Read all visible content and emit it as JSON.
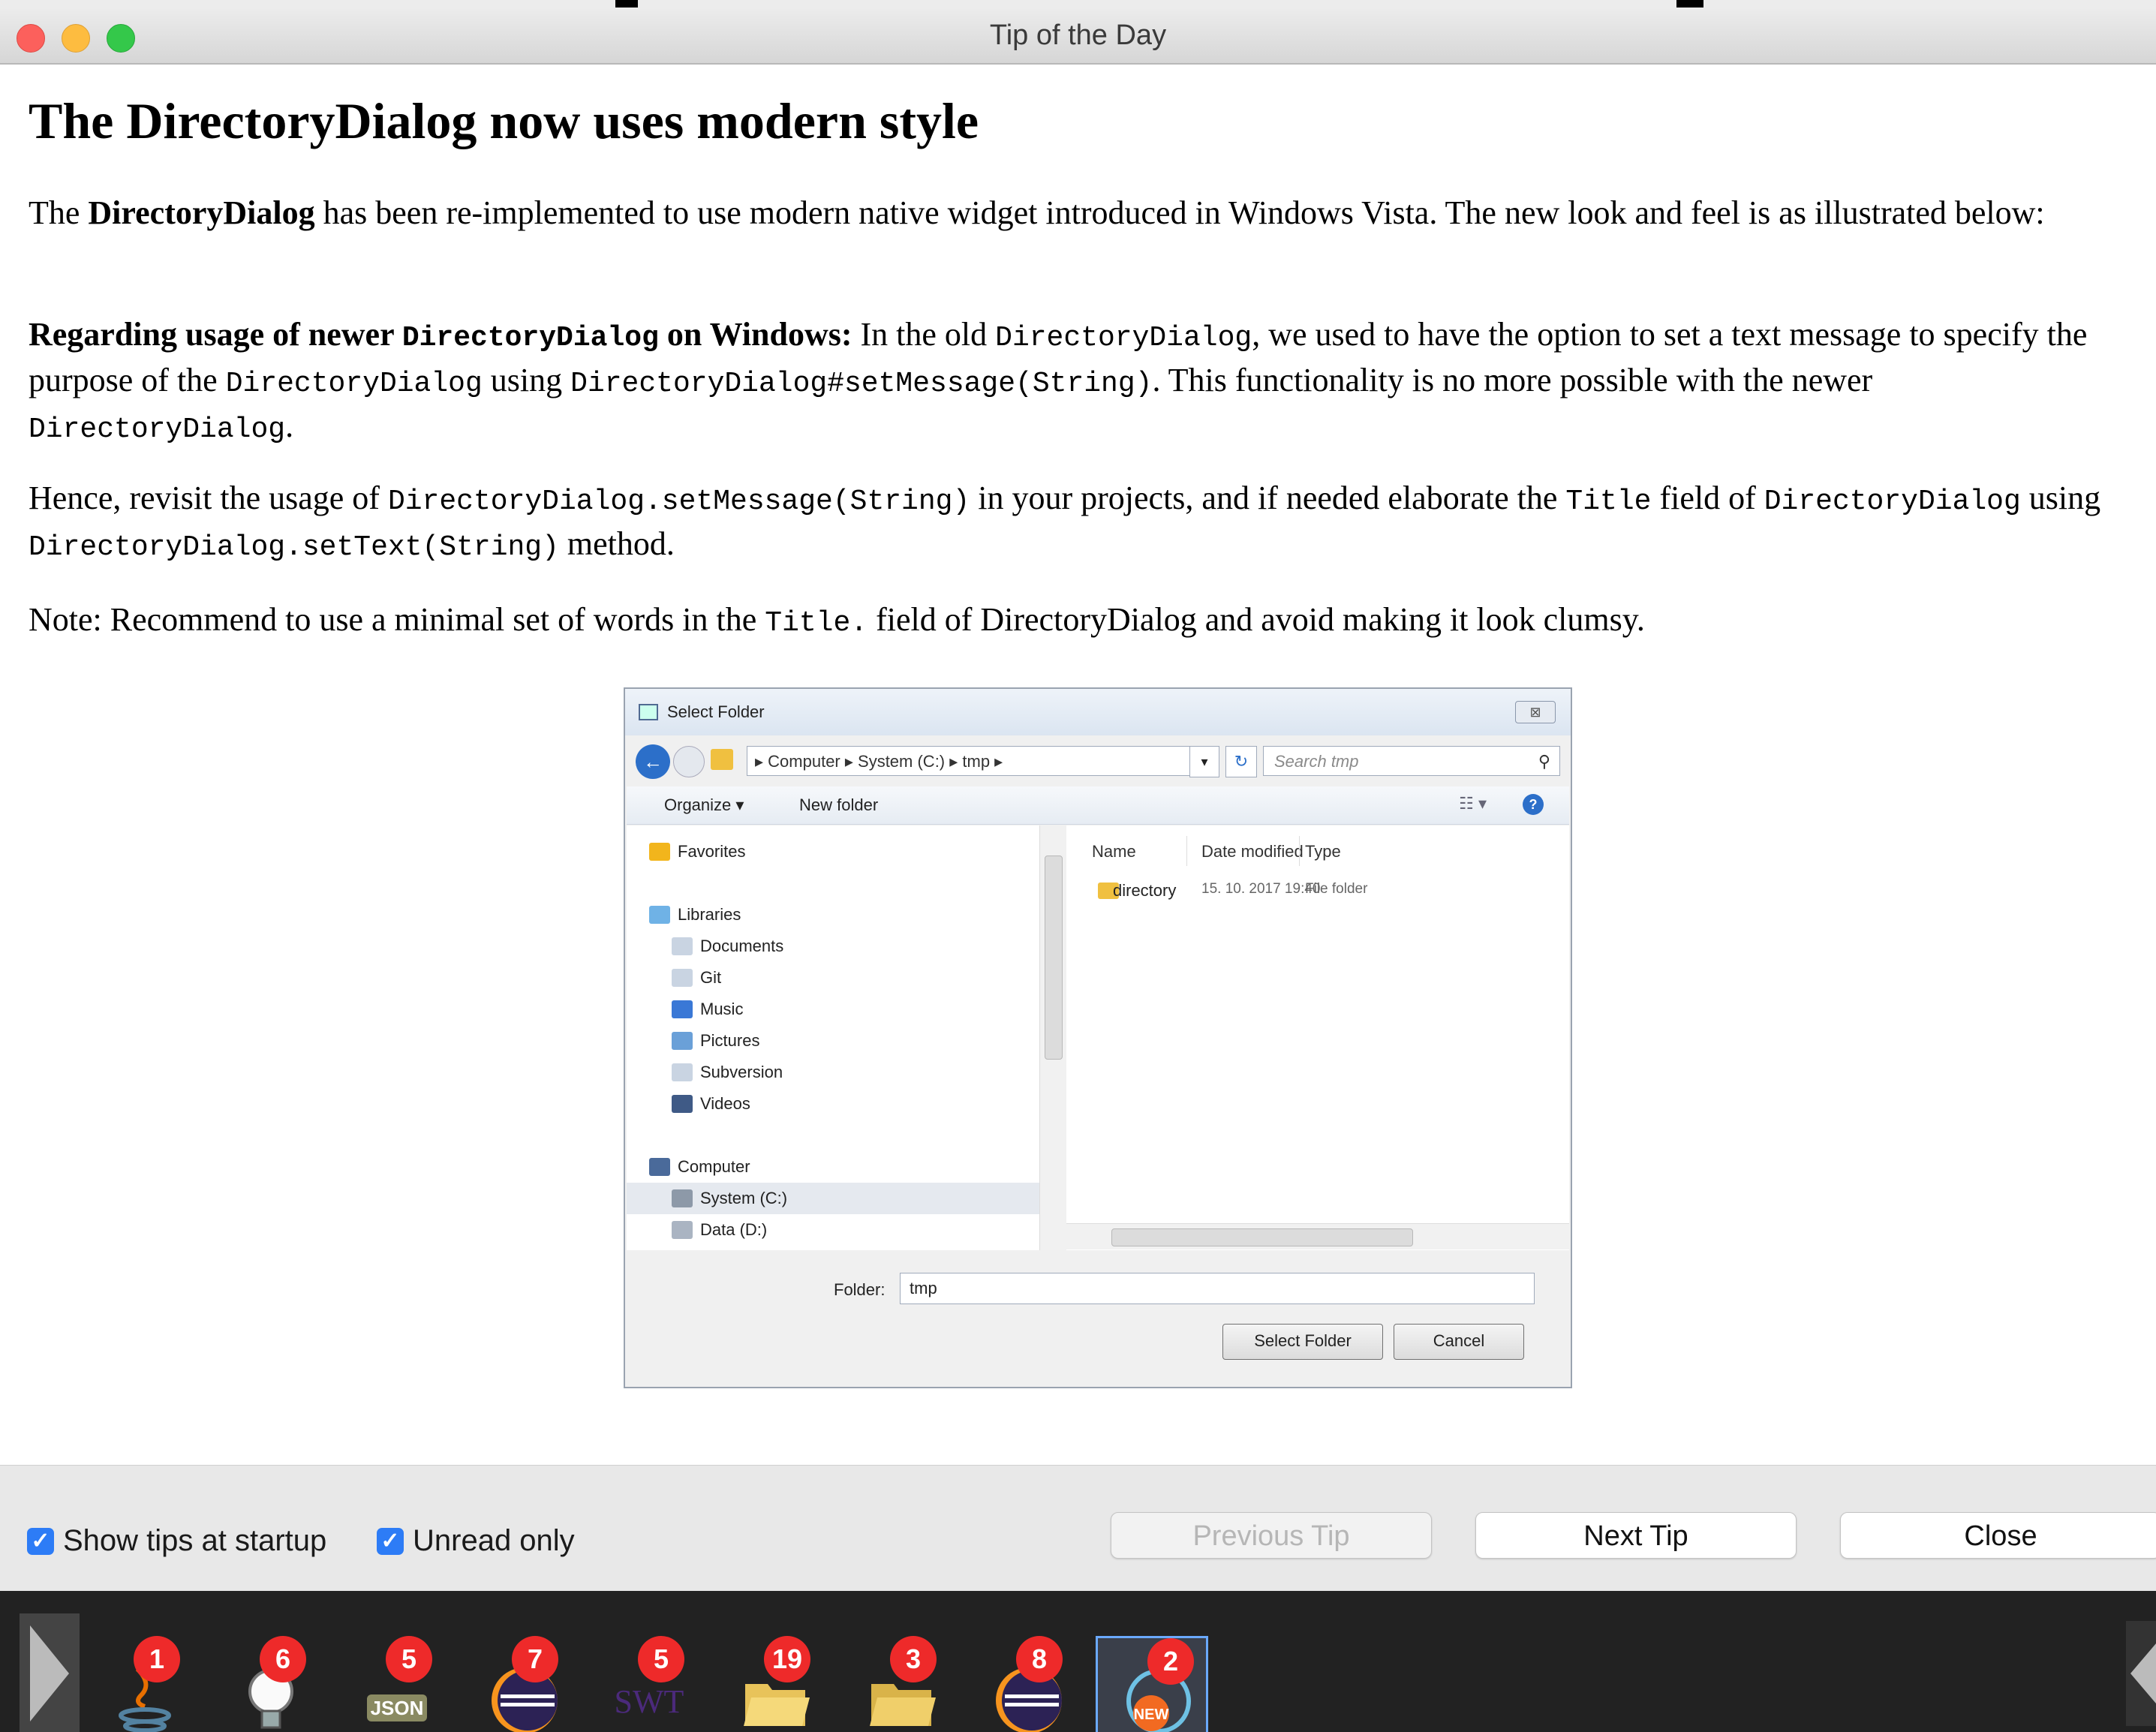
{
  "window": {
    "title": "Tip of the Day"
  },
  "tip": {
    "heading": "The DirectoryDialog now uses modern style",
    "p1": {
      "a": "The ",
      "b": "DirectoryDialog",
      "c": " has been re-implemented to use modern native widget introduced in Windows Vista. The new look and feel is as illustrated below:"
    },
    "p2": {
      "bold_a": "Regarding usage of newer ",
      "code_a": "DirectoryDialog",
      "bold_b": " on Windows:",
      "t1": " In the old ",
      "code_b": "DirectoryDialog",
      "t2": ", we used to have the option to set a text message to specify the purpose of the ",
      "code_c": "DirectoryDialog",
      "t3": " using ",
      "code_d": "DirectoryDialog#setMessage(String)",
      "t4": ". This functionality is no more possible with the newer ",
      "code_e": "DirectoryDialog",
      "t5": "."
    },
    "p3": {
      "t1": "Hence, revisit the usage of ",
      "code_a": "DirectoryDialog.setMessage(String)",
      "t2": " in your projects, and if needed elaborate the ",
      "code_b": "Title",
      "t3": " field of ",
      "code_c": "DirectoryDialog",
      "t4": " using ",
      "code_d": "DirectoryDialog.setText(String)",
      "t5": " method."
    },
    "p4": {
      "t1": "Note: Recommend to use a minimal set of words in the ",
      "code_a": "Title.",
      "t2": " field of DirectoryDialog and avoid making it look clumsy."
    }
  },
  "shot": {
    "title": "Select Folder",
    "close": "⊠",
    "breadcrumb": "▸  Computer  ▸  System (C:)  ▸  tmp  ▸",
    "search_placeholder": "Search tmp",
    "organize": "Organize ▾",
    "new_folder": "New folder",
    "nav": [
      {
        "label": "Favorites",
        "color": "#f2b51c"
      },
      {
        "label": "Libraries",
        "color": "#6fb2e6"
      },
      {
        "label": "Documents",
        "color": "#c9d4e2"
      },
      {
        "label": "Git",
        "color": "#c9d4e2"
      },
      {
        "label": "Music",
        "color": "#3a78d6"
      },
      {
        "label": "Pictures",
        "color": "#6aa0d8"
      },
      {
        "label": "Subversion",
        "color": "#c9d4e2"
      },
      {
        "label": "Videos",
        "color": "#3f5a86"
      },
      {
        "label": "Computer",
        "color": "#4a6a9a"
      },
      {
        "label": "System (C:)",
        "color": "#8d99a8"
      },
      {
        "label": "Data (D:)",
        "color": "#aab4c2"
      }
    ],
    "columns": {
      "name": "Name",
      "date": "Date modified",
      "type": "Type"
    },
    "file": {
      "name": "directory",
      "date": "15. 10. 2017 19:40",
      "type": "File folder"
    },
    "folder_label": "Folder:",
    "folder_value": "tmp",
    "select_btn": "Select Folder",
    "cancel_btn": "Cancel"
  },
  "controls": {
    "show_tips": "Show tips at startup",
    "unread_only": "Unread only",
    "previous": "Previous Tip",
    "next": "Next Tip",
    "close": "Close"
  },
  "dock": [
    {
      "name": "java-icon",
      "badge": "1"
    },
    {
      "name": "lightbulb-icon",
      "badge": "6"
    },
    {
      "name": "json-icon",
      "badge": "5",
      "text": "JSON"
    },
    {
      "name": "eclipse-icon",
      "badge": "7"
    },
    {
      "name": "swt-icon",
      "badge": "5",
      "text": "SWT"
    },
    {
      "name": "folder-open-icon",
      "badge": "19"
    },
    {
      "name": "folder-icon",
      "badge": "3"
    },
    {
      "name": "eclipse-icon",
      "badge": "8"
    },
    {
      "name": "new-feature-icon",
      "badge": "2",
      "text": "NEW"
    }
  ]
}
